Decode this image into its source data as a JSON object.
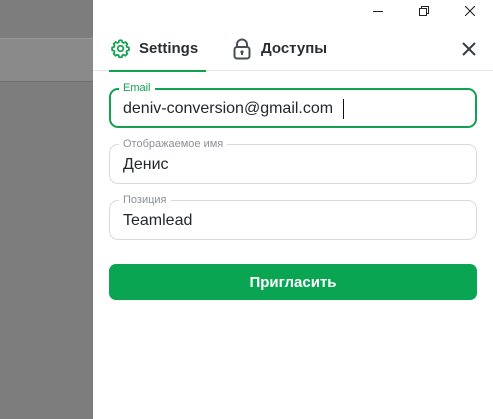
{
  "window": {
    "controls": [
      {
        "name": "minimize-button",
        "icon": "minimize-icon"
      },
      {
        "name": "maximize-button",
        "icon": "restore-icon"
      },
      {
        "name": "close-window-button",
        "icon": "close-icon"
      }
    ]
  },
  "tabs": [
    {
      "label": "Settings",
      "icon": "gear-icon",
      "active": true
    },
    {
      "label": "Доступы",
      "icon": "lock-icon",
      "active": false
    }
  ],
  "form": {
    "email": {
      "label": "Email",
      "value": "deniv-conversion@gmail.com",
      "focused": true
    },
    "display_name": {
      "label": "Отображаемое имя",
      "value": "Денис"
    },
    "position": {
      "label": "Позиция",
      "value": "Teamlead"
    }
  },
  "actions": {
    "invite_label": "Пригласить"
  },
  "colors": {
    "accent": "#12a150",
    "button": "#09a552",
    "backdrop": "#7d7d7d",
    "text": "#24282c"
  }
}
